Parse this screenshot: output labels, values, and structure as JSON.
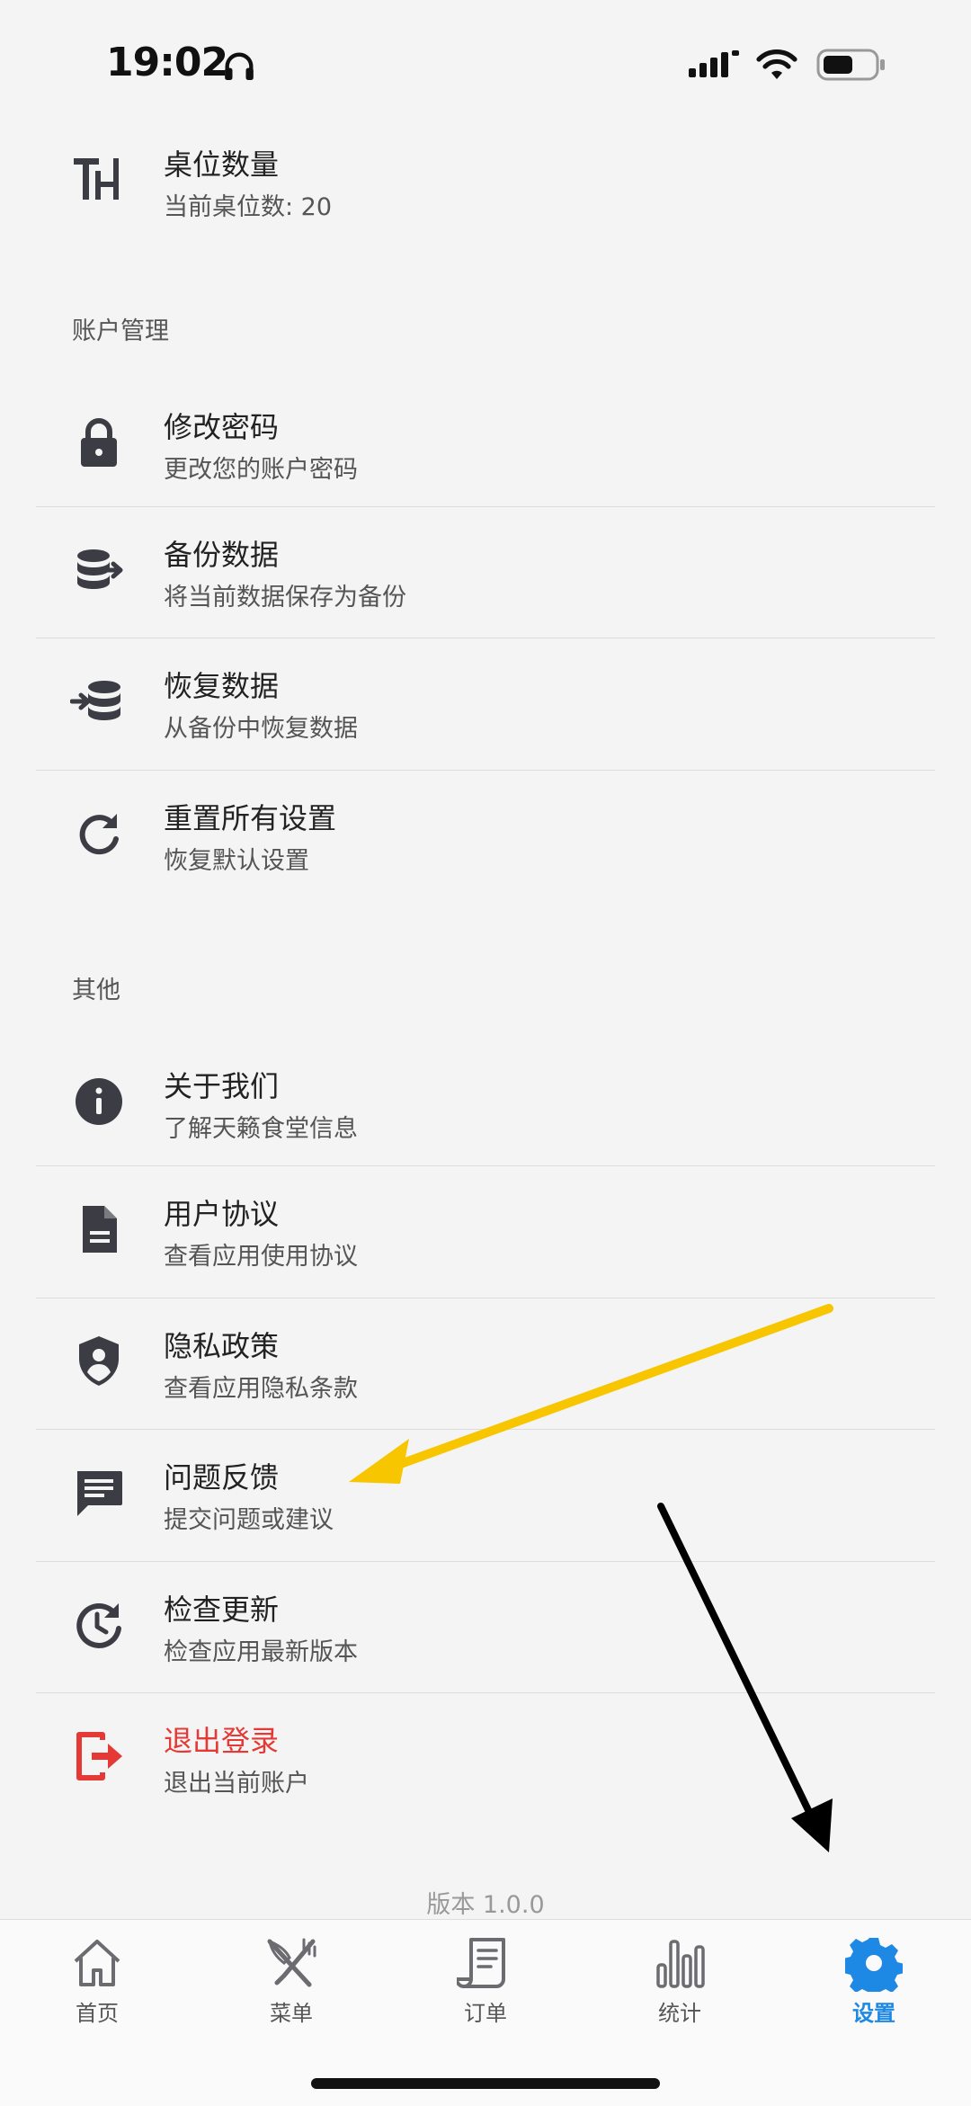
{
  "status_bar": {
    "time": "19:02"
  },
  "rows_top": [
    {
      "name": "table-count",
      "icon": "table-icon",
      "title": "桌位数量",
      "subtitle": "当前桌位数: 20"
    }
  ],
  "sections": [
    {
      "header": "账户管理",
      "items": [
        {
          "icon": "lock-icon",
          "title": "修改密码",
          "subtitle": "更改您的账户密码"
        },
        {
          "icon": "backup-database-icon",
          "title": "备份数据",
          "subtitle": "将当前数据保存为备份"
        },
        {
          "icon": "restore-database-icon",
          "title": "恢复数据",
          "subtitle": "从备份中恢复数据"
        },
        {
          "icon": "refresh-icon",
          "title": "重置所有设置",
          "subtitle": "恢复默认设置"
        }
      ]
    },
    {
      "header": "其他",
      "items": [
        {
          "icon": "info-icon",
          "title": "关于我们",
          "subtitle": "了解天籁食堂信息"
        },
        {
          "icon": "document-icon",
          "title": "用户协议",
          "subtitle": "查看应用使用协议"
        },
        {
          "icon": "shield-user-icon",
          "title": "隐私政策",
          "subtitle": "查看应用隐私条款"
        },
        {
          "icon": "feedback-icon",
          "title": "问题反馈",
          "subtitle": "提交问题或建议"
        },
        {
          "icon": "update-history-icon",
          "title": "检查更新",
          "subtitle": "检查应用最新版本"
        },
        {
          "icon": "logout-icon",
          "title": "退出登录",
          "subtitle": "退出当前账户"
        }
      ]
    }
  ],
  "version": "版本 1.0.0",
  "tabs": [
    {
      "icon": "home-icon",
      "label": "首页"
    },
    {
      "icon": "fork-knife-icon",
      "label": "菜单"
    },
    {
      "icon": "receipt-icon",
      "label": "订单"
    },
    {
      "icon": "bar-chart-icon",
      "label": "统计"
    },
    {
      "icon": "gear-icon",
      "label": "设置",
      "active": true
    }
  ],
  "colors": {
    "accent": "#1e88e5",
    "danger": "#e53935",
    "icon": "#3c3c44",
    "arrow_yellow": "#f7c600",
    "arrow_black": "#000000"
  }
}
